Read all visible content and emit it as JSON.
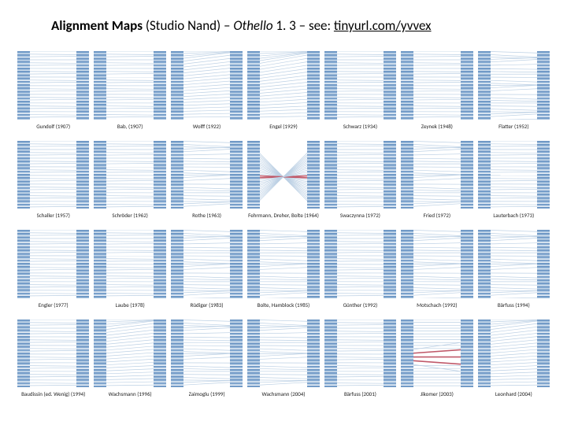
{
  "title": {
    "bold": "Alignment Maps",
    "attribution": " (Studio Nand) – ",
    "work_title": "Othello",
    "section": " 1. 3 – see: ",
    "link_text": "tinyurl.com/yvvex"
  },
  "cells": [
    {
      "label": "Gundolf (1907)",
      "variant": "straight"
    },
    {
      "label": "Bab, (1907)",
      "variant": "straight"
    },
    {
      "label": "Wolff (1922)",
      "variant": "diverge-up"
    },
    {
      "label": "Engel (1929)",
      "variant": "diverge-up2"
    },
    {
      "label": "Schwarz (1934)",
      "variant": "straight"
    },
    {
      "label": "Zeynek (1948)",
      "variant": "straight"
    },
    {
      "label": "Flatter (1952)",
      "variant": "slight"
    },
    {
      "label": "Schaller (1957)",
      "variant": "straight"
    },
    {
      "label": "Schröder (1962)",
      "variant": "straight"
    },
    {
      "label": "Rothe (1963)",
      "variant": "slight"
    },
    {
      "label": "Fehrmann, Dreher, Bolte (1964)",
      "variant": "cross"
    },
    {
      "label": "Swaczynna (1972)",
      "variant": "straight"
    },
    {
      "label": "Fried (1972)",
      "variant": "slight"
    },
    {
      "label": "Lauterbach (1973)",
      "variant": "straight"
    },
    {
      "label": "Engler (1977)",
      "variant": "straight"
    },
    {
      "label": "Laube (1978)",
      "variant": "straight"
    },
    {
      "label": "Rüdiger (1983)",
      "variant": "slight"
    },
    {
      "label": "Bolte, Hamblock (1985)",
      "variant": "slight"
    },
    {
      "label": "Günther (1992)",
      "variant": "straight"
    },
    {
      "label": "Motschach (1992)",
      "variant": "slight"
    },
    {
      "label": "Bärfuss (1994)",
      "variant": "slight"
    },
    {
      "label": "Baudissin (ed. Wenig) (1994)",
      "variant": "straight"
    },
    {
      "label": "Wachsmann (1996)",
      "variant": "diverge-up"
    },
    {
      "label": "Zaimoglu (1999)",
      "variant": "slight"
    },
    {
      "label": "Wachsmann (2004)",
      "variant": "slight"
    },
    {
      "label": "Bärfuss (2001)",
      "variant": "straight"
    },
    {
      "label": "Jikomer (2003)",
      "variant": "red-fan"
    },
    {
      "label": "Leonhard (2004)",
      "variant": "diverge-up"
    }
  ]
}
